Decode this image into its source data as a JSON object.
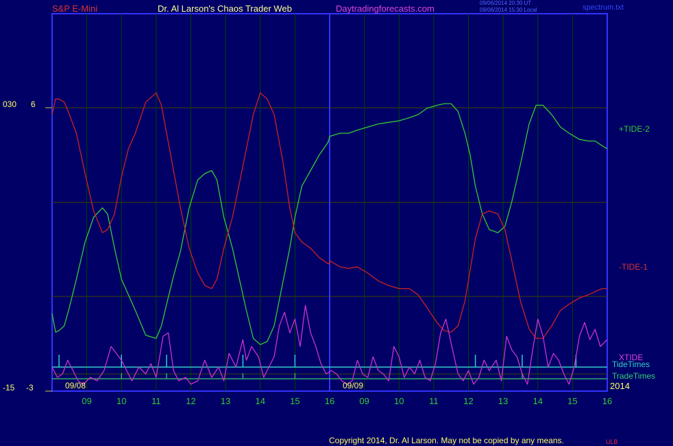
{
  "header": {
    "instrument": "S&P E-Mini",
    "site": "Dr. Al Larson's Chaos Trader Web",
    "domain": "Daytradingforecasts.com",
    "timestamp_ut": "09/06/2014 20:30 UT",
    "timestamp_local": "09/06/2014 15:30 Local",
    "file": "spectrum.txt"
  },
  "footer": {
    "copyright": "Copyright 2014, Dr. Al Larson. May not be copied by any means.",
    "mark": "ULB"
  },
  "colors": {
    "background": "#000066",
    "plot_border": "#3333ff",
    "grid_h": "#444400",
    "grid_v": "#004400",
    "session_line": "#3333ff",
    "tide_plus": "#33cc33",
    "tide_minus": "#cc2222",
    "xtide": "#cc33cc",
    "tide_times": "#33cccc",
    "trade_times": "#33aa66",
    "date_label": "#ffff66",
    "hour_label": "#33cc33"
  },
  "chart_data": {
    "type": "line",
    "left_axis": {
      "ticks": [
        {
          "outer": "030",
          "inner": "6"
        },
        {
          "outer": "-15",
          "inner": "-3"
        }
      ]
    },
    "x_hour_labels": [
      "09",
      "10",
      "11",
      "12",
      "13",
      "14",
      "15",
      "16",
      "09",
      "10",
      "11",
      "12",
      "13",
      "14",
      "15",
      "16"
    ],
    "date_labels": [
      "09/08",
      "09/09"
    ],
    "year_label": "2014",
    "x_range": [
      8.0,
      24.0
    ],
    "y_range": [
      0,
      10
    ],
    "series": [
      {
        "name": "+TIDE-2",
        "color_key": "tide_plus",
        "x": [
          8.0,
          8.1,
          8.2,
          8.35,
          8.5,
          8.7,
          8.95,
          9.2,
          9.45,
          9.6,
          9.8,
          10.0,
          10.2,
          10.4,
          10.7,
          11.0,
          11.15,
          11.3,
          11.5,
          11.7,
          11.95,
          12.2,
          12.4,
          12.6,
          12.75,
          12.95,
          13.2,
          13.4,
          13.6,
          13.8,
          14.0,
          14.2,
          14.4,
          14.65,
          14.85,
          15.0,
          15.2,
          15.45,
          15.7,
          15.95,
          15.98,
          16.0,
          16.3,
          16.55,
          16.8,
          17.1,
          17.4,
          17.7,
          18.0,
          18.3,
          18.55,
          18.8,
          19.1,
          19.3,
          19.5,
          19.7,
          19.9,
          20.05,
          20.2,
          20.4,
          20.6,
          20.85,
          21.05,
          21.25,
          21.5,
          21.75,
          21.95,
          22.15,
          22.4,
          22.65,
          22.9,
          23.2,
          23.45,
          23.65,
          23.85,
          24.0
        ],
        "values": [
          2.4,
          1.8,
          1.85,
          2.0,
          2.6,
          3.5,
          4.7,
          5.5,
          5.8,
          5.6,
          4.5,
          3.5,
          3.0,
          2.5,
          1.7,
          1.6,
          2.0,
          2.7,
          3.6,
          4.4,
          5.8,
          6.7,
          6.9,
          7.0,
          6.7,
          5.5,
          4.5,
          3.5,
          2.5,
          1.6,
          1.4,
          1.5,
          2.0,
          3.4,
          4.5,
          5.5,
          6.5,
          7.0,
          7.5,
          7.9,
          8.0,
          8.1,
          8.2,
          8.2,
          8.3,
          8.4,
          8.5,
          8.55,
          8.6,
          8.7,
          8.8,
          9.0,
          9.1,
          9.15,
          9.15,
          8.9,
          8.2,
          7.5,
          6.5,
          5.6,
          5.1,
          5.0,
          5.2,
          6.0,
          7.2,
          8.5,
          9.1,
          9.1,
          8.8,
          8.4,
          8.2,
          8.0,
          7.95,
          7.95,
          7.8,
          7.7
        ]
      },
      {
        "name": "-TIDE-1",
        "color_key": "tide_minus",
        "x": [
          8.0,
          8.1,
          8.2,
          8.35,
          8.5,
          8.7,
          8.95,
          9.2,
          9.45,
          9.6,
          9.8,
          10.0,
          10.2,
          10.4,
          10.7,
          11.0,
          11.15,
          11.3,
          11.5,
          11.7,
          11.95,
          12.2,
          12.4,
          12.6,
          12.75,
          12.95,
          13.2,
          13.4,
          13.6,
          13.8,
          14.0,
          14.2,
          14.4,
          14.65,
          14.85,
          15.0,
          15.2,
          15.45,
          15.7,
          15.95,
          15.98,
          16.0,
          16.3,
          16.55,
          16.8,
          17.1,
          17.4,
          17.7,
          18.0,
          18.3,
          18.55,
          18.8,
          19.1,
          19.3,
          19.5,
          19.7,
          19.9,
          20.05,
          20.2,
          20.4,
          20.6,
          20.85,
          21.05,
          21.25,
          21.5,
          21.75,
          21.95,
          22.15,
          22.4,
          22.65,
          22.9,
          23.2,
          23.45,
          23.65,
          23.85,
          24.0
        ],
        "values": [
          8.8,
          9.3,
          9.3,
          9.2,
          8.8,
          8.2,
          6.9,
          5.7,
          5.0,
          5.1,
          5.6,
          6.8,
          7.7,
          8.2,
          9.2,
          9.5,
          9.1,
          8.2,
          7.0,
          5.8,
          4.5,
          3.7,
          3.3,
          3.2,
          3.5,
          4.5,
          5.5,
          6.6,
          7.7,
          8.8,
          9.5,
          9.3,
          8.8,
          7.3,
          5.8,
          5.0,
          4.7,
          4.5,
          4.2,
          4.0,
          4.0,
          4.1,
          3.9,
          3.85,
          3.9,
          3.7,
          3.45,
          3.3,
          3.2,
          3.2,
          3.0,
          2.6,
          2.1,
          1.85,
          1.8,
          2.0,
          2.8,
          3.8,
          4.8,
          5.6,
          5.7,
          5.6,
          5.1,
          4.1,
          2.8,
          1.9,
          1.6,
          1.6,
          2.0,
          2.5,
          2.7,
          2.9,
          3.0,
          3.1,
          3.2,
          3.2
        ]
      },
      {
        "name": "XTIDE",
        "color_key": "xtide",
        "x": [
          8.0,
          8.15,
          8.3,
          8.45,
          8.6,
          8.75,
          8.9,
          9.1,
          9.3,
          9.5,
          9.7,
          9.85,
          10.0,
          10.15,
          10.3,
          10.5,
          10.7,
          10.85,
          11.0,
          11.2,
          11.35,
          11.5,
          11.65,
          11.85,
          12.0,
          12.2,
          12.4,
          12.6,
          12.8,
          12.95,
          13.1,
          13.3,
          13.5,
          13.6,
          13.75,
          13.95,
          14.1,
          14.25,
          14.4,
          14.55,
          14.7,
          14.85,
          15.0,
          15.15,
          15.3,
          15.45,
          15.6,
          15.75,
          15.9,
          16.05,
          16.2,
          16.35,
          16.5,
          16.65,
          16.8,
          16.95,
          17.1,
          17.25,
          17.4,
          17.55,
          17.7,
          17.85,
          18.0,
          18.15,
          18.3,
          18.45,
          18.6,
          18.75,
          18.9,
          19.05,
          19.2,
          19.35,
          19.5,
          19.7,
          19.85,
          20.0,
          20.15,
          20.3,
          20.45,
          20.6,
          20.8,
          20.95,
          21.1,
          21.25,
          21.4,
          21.55,
          21.7,
          21.85,
          22.0,
          22.15,
          22.3,
          22.45,
          22.6,
          22.75,
          22.9,
          23.05,
          23.2,
          23.35,
          23.5,
          23.65,
          23.8,
          24.0
        ],
        "values": [
          0.6,
          0.3,
          0.4,
          0.8,
          0.5,
          0.2,
          0.1,
          0.3,
          0.2,
          0.5,
          1.2,
          1.0,
          0.8,
          0.5,
          0.2,
          0.6,
          0.4,
          0.7,
          0.3,
          1.5,
          1.6,
          0.5,
          0.2,
          0.3,
          0.1,
          0.2,
          0.8,
          0.3,
          0.6,
          0.2,
          1.0,
          0.6,
          1.4,
          0.8,
          1.2,
          0.9,
          0.3,
          0.6,
          0.9,
          1.8,
          2.2,
          1.6,
          2.0,
          1.2,
          2.4,
          1.6,
          1.2,
          0.7,
          0.4,
          0.5,
          0.4,
          0.2,
          0.1,
          0.2,
          0.8,
          0.4,
          0.3,
          0.9,
          0.5,
          0.4,
          0.2,
          1.2,
          0.9,
          0.3,
          0.6,
          0.4,
          0.8,
          0.3,
          0.2,
          0.7,
          1.6,
          2.0,
          1.3,
          0.4,
          0.2,
          0.5,
          0.1,
          0.3,
          0.8,
          0.5,
          0.8,
          0.2,
          1.5,
          1.1,
          0.9,
          0.4,
          0.1,
          1.1,
          2.0,
          1.5,
          0.6,
          1.0,
          0.8,
          0.4,
          0.1,
          0.6,
          1.5,
          1.9,
          1.4,
          1.7,
          1.2,
          1.4
        ]
      }
    ],
    "tide_times_x": [
      8.2,
      10.0,
      11.3,
      13.5,
      15.0,
      20.2,
      21.55,
      23.1
    ],
    "trade_times_x": [
      10.0,
      11.3,
      13.5,
      15.0,
      21.55
    ],
    "legend": {
      "tide_plus": "+TIDE-2",
      "tide_minus": "-TIDE-1",
      "xtide": "XTIDE",
      "tide_times": "TideTimes",
      "trade_times": "TradeTimes"
    },
    "grid": true
  }
}
